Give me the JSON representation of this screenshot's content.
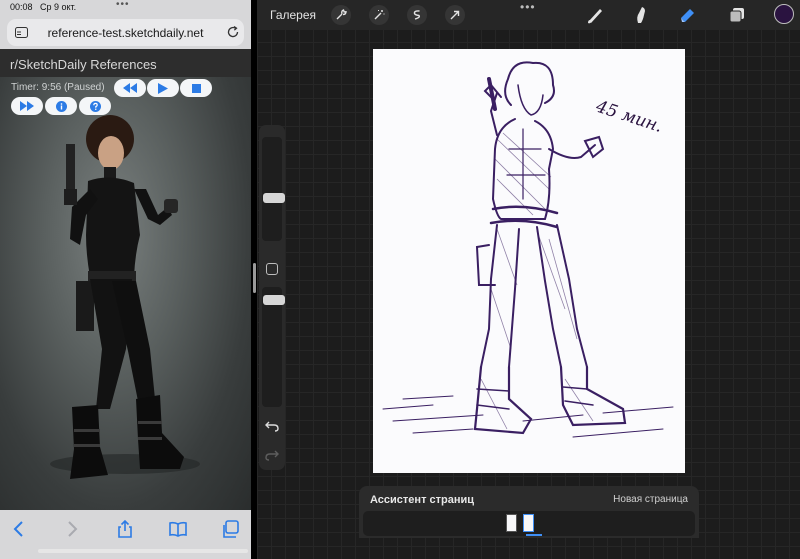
{
  "status_bar": {
    "time": "00:08",
    "date": "Ср 9 окт.",
    "multitask_dots": "•••"
  },
  "safari": {
    "url": "reference-test.sketchdaily.net",
    "tabs_icon": "tabs-icon",
    "reload_icon": "reload-icon",
    "toolbar_icons": [
      "back-icon",
      "forward-icon",
      "share-icon",
      "bookmarks-icon",
      "tabs-icon"
    ]
  },
  "webpage": {
    "title": "r/SketchDaily References",
    "timer": "Timer: 9:56 (Paused)",
    "controls": [
      "rewind-icon",
      "play-icon",
      "stop-icon",
      "fast-forward-icon",
      "info-icon",
      "help-icon"
    ],
    "accent": "#2c7be5"
  },
  "procreate": {
    "gallery_label": "Галерея",
    "more_dots": "•••",
    "left_tools": [
      "wrench-icon",
      "magic-wand-icon",
      "selection-icon",
      "transform-arrow-icon"
    ],
    "right_tools": [
      "brush-icon",
      "smudge-icon",
      "eraser-icon",
      "layers-icon"
    ],
    "active_tool": "eraser-icon",
    "active_color": "#2a1340",
    "canvas_annotation": "45 мин.",
    "assistant_title": "Ассистент страниц",
    "new_page_label": "Новая страница",
    "page_count": 2,
    "accent": "#3f8ff6"
  }
}
